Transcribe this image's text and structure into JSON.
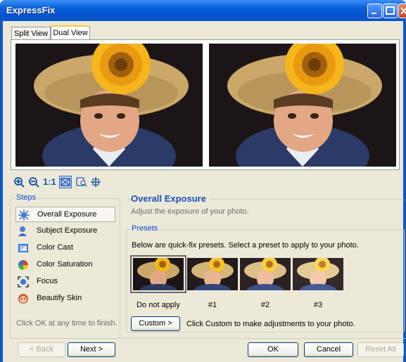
{
  "window": {
    "title": "ExpressFix"
  },
  "tabs": [
    {
      "label": "Split View"
    },
    {
      "label": "Dual View",
      "active": true
    }
  ],
  "view_toolbar": [
    {
      "icon": "zoom-in-icon"
    },
    {
      "icon": "zoom-out-icon"
    },
    {
      "label": "1:1"
    },
    {
      "icon": "fit-window-icon",
      "selected": true
    },
    {
      "icon": "zoom-tool-icon"
    },
    {
      "icon": "pan-tool-icon"
    }
  ],
  "steps": {
    "title": "Steps",
    "items": [
      {
        "label": "Overall Exposure",
        "icon": "exposure-icon",
        "selected": true
      },
      {
        "label": "Subject Exposure",
        "icon": "subject-icon"
      },
      {
        "label": "Color Cast",
        "icon": "color-cast-icon"
      },
      {
        "label": "Color Saturation",
        "icon": "saturation-icon"
      },
      {
        "label": "Focus",
        "icon": "focus-icon"
      },
      {
        "label": "Beautify Skin",
        "icon": "beautify-skin-icon"
      }
    ],
    "hint": "Click OK at any time to finish."
  },
  "section": {
    "title": "Overall Exposure",
    "description": "Adjust the exposure of your photo."
  },
  "presets": {
    "title": "Presets",
    "description": "Below are quick-fix presets. Select a preset to apply to your photo.",
    "items": [
      {
        "label": "Do not apply",
        "selected": true
      },
      {
        "label": "#1"
      },
      {
        "label": "#2"
      },
      {
        "label": "#3"
      }
    ],
    "custom_button": "Custom >",
    "custom_hint": "Click Custom to make adjustments to your photo."
  },
  "footer": {
    "back": "< Back",
    "next": "Next >",
    "ok": "OK",
    "cancel": "Cancel",
    "reset_all": "Reset All"
  },
  "colors": {
    "title_blue": "#0a5fd9",
    "group_label": "#0046d5",
    "heading": "#1e4fbd",
    "face": "#ece9d8"
  }
}
